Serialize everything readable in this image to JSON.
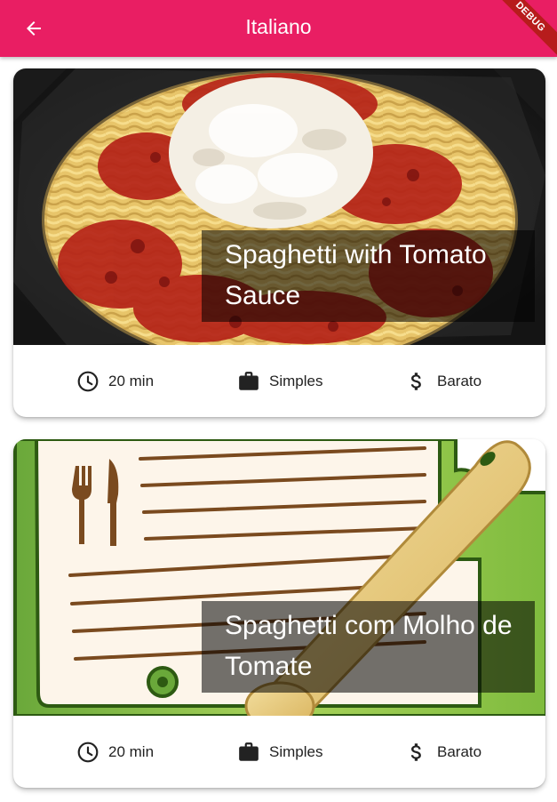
{
  "appbar": {
    "title": "Italiano",
    "back_icon": "arrow-back-icon",
    "color": "#e91e63",
    "debug_label": "DEBUG"
  },
  "meals": [
    {
      "title": "Spaghetti with Tomato Sauce",
      "duration": "20 min",
      "complexity": "Simples",
      "cost": "Barato",
      "image": "spaghetti-photo"
    },
    {
      "title": "Spaghetti com Molho de Tomate",
      "duration": "20 min",
      "complexity": "Simples",
      "cost": "Barato",
      "image": "recipe-card-illustration"
    }
  ],
  "icons": {
    "duration": "schedule-icon",
    "complexity": "work-icon",
    "cost": "attach-money-icon"
  }
}
